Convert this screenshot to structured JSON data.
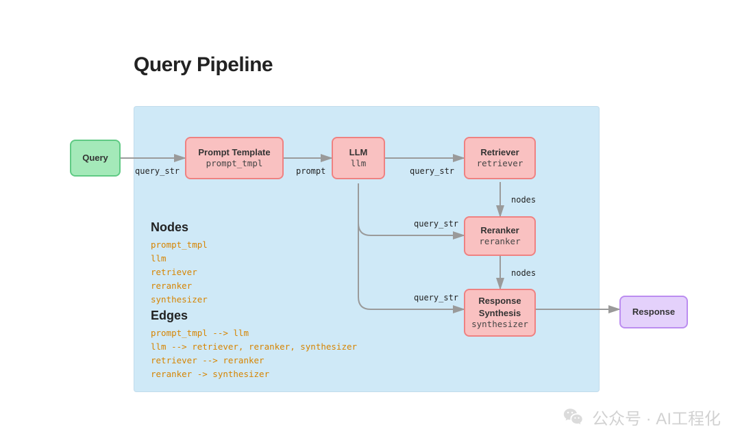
{
  "title": "Query Pipeline",
  "nodes": {
    "query": {
      "title": "Query"
    },
    "prompt_tmpl": {
      "title": "Prompt Template",
      "sub": "prompt_tmpl"
    },
    "llm": {
      "title": "LLM",
      "sub": "llm"
    },
    "retriever": {
      "title": "Retriever",
      "sub": "retriever"
    },
    "reranker": {
      "title": "Reranker",
      "sub": "reranker"
    },
    "synthesizer": {
      "title": "Response Synthesis",
      "sub": "synthesizer"
    },
    "response": {
      "title": "Response"
    }
  },
  "edge_labels": {
    "query_to_prompt": "query_str",
    "prompt_to_llm": "prompt",
    "llm_to_retriever": "query_str",
    "retriever_to_reranker": "nodes",
    "llm_to_reranker": "query_str",
    "reranker_to_synth": "nodes",
    "llm_to_synth": "query_str"
  },
  "sections": {
    "nodes_heading": "Nodes",
    "nodes_list": "prompt_tmpl\nllm\nretriever\nreranker\nsynthesizer",
    "edges_heading": "Edges",
    "edges_list": "prompt_tmpl --> llm\nllm --> retriever, reranker, synthesizer\nretriever --> reranker\nreranker -> synthesizer"
  },
  "watermark": "公众号 · AI工程化"
}
